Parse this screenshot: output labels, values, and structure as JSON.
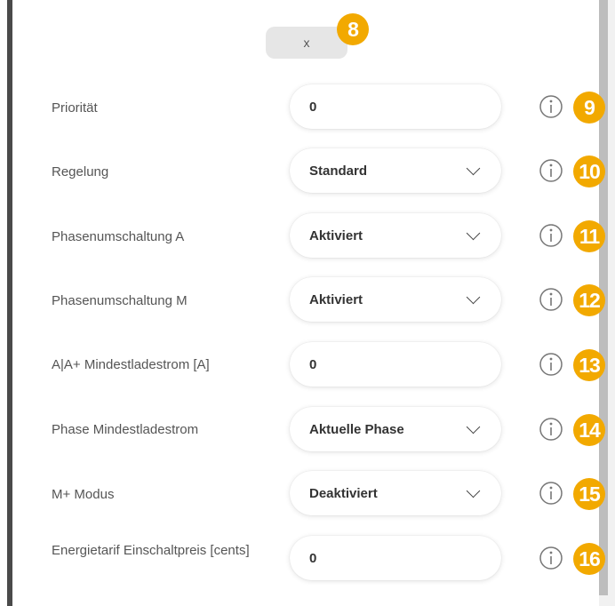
{
  "close_button": {
    "label": "x"
  },
  "badges": {
    "close": "8"
  },
  "rows": [
    {
      "label": "Priorität",
      "value": "0",
      "type": "input",
      "badge": "9"
    },
    {
      "label": "Regelung",
      "value": "Standard",
      "type": "select",
      "badge": "10"
    },
    {
      "label": "Phasenumschaltung A",
      "value": "Aktiviert",
      "type": "select",
      "badge": "11"
    },
    {
      "label": "Phasenumschaltung M",
      "value": "Aktiviert",
      "type": "select",
      "badge": "12"
    },
    {
      "label": "A|A+ Mindestladestrom [A]",
      "value": "0",
      "type": "input",
      "badge": "13"
    },
    {
      "label": "Phase Mindestladestrom",
      "value": "Aktuelle Phase",
      "type": "select",
      "badge": "14"
    },
    {
      "label": "M+ Modus",
      "value": "Deaktiviert",
      "type": "select",
      "badge": "15"
    },
    {
      "label": "Energietarif Einschaltpreis [cents]",
      "value": "0",
      "type": "input",
      "badge": "16"
    }
  ],
  "icons": {
    "info": "info-circle-icon",
    "dropdown": "chevron-down-icon"
  },
  "colors": {
    "badge": "#f2a900",
    "text": "#555555",
    "value": "#333333"
  }
}
